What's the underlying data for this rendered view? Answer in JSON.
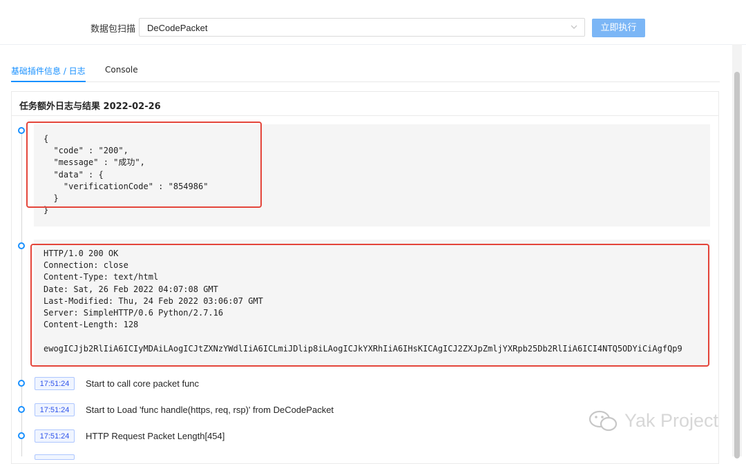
{
  "scan": {
    "label": "数据包扫描",
    "selected": "DeCodePacket",
    "run_button": "立即执行"
  },
  "tabs": [
    {
      "label": "基础插件信息 / 日志",
      "active": true
    },
    {
      "label": "Console",
      "active": false
    }
  ],
  "card": {
    "title": "任务额外日志与结果  2022-02-26"
  },
  "entries": {
    "json_block": "{\n  \"code\" : \"200\",\n  \"message\" : \"成功\",\n  \"data\" : {\n    \"verificationCode\" : \"854986\"\n  }\n}",
    "http_block": "HTTP/1.0 200 OK\nConnection: close\nContent-Type: text/html\nDate: Sat, 26 Feb 2022 04:07:08 GMT\nLast-Modified: Thu, 24 Feb 2022 03:06:07 GMT\nServer: SimpleHTTP/0.6 Python/2.7.16\nContent-Length: 128\n\newogICJjb2RlIiA6ICIyMDAiLAogICJtZXNzYWdlIiA6ICLmiJDlip8iLAogICJkYXRhIiA6IHsKICAgICJ2ZXJpZmljYXRpb25Db2RlIiA6ICI4NTQ5ODYiCiAgfQp9"
  },
  "logs": [
    {
      "time": "17:51:24",
      "message": "Start to call core packet func"
    },
    {
      "time": "17:51:24",
      "message": "Start to Load 'func handle(https, req, rsp)' from DeCodePacket"
    },
    {
      "time": "17:51:24",
      "message": "HTTP Request Packet Length[454]"
    }
  ],
  "watermark": "Yak Project",
  "colors": {
    "accent": "#1890ff",
    "run_button": "#7bb6f6",
    "highlight_box": "#e4453a",
    "code_bg": "#f5f5f5"
  },
  "icons": {
    "select_arrow": "chevron-down-icon",
    "watermark_logo": "wechat-icon"
  }
}
